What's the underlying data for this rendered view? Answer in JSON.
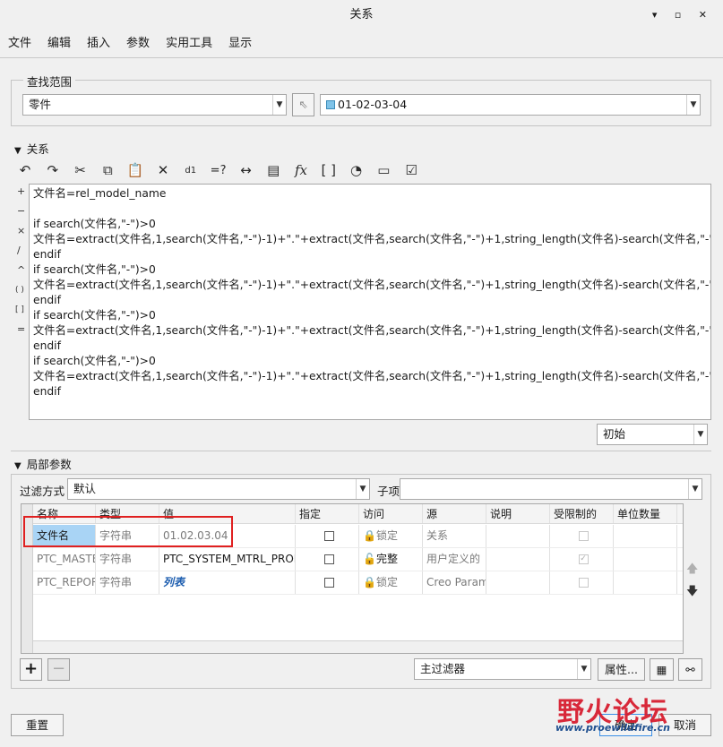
{
  "window": {
    "title": "关系",
    "buttons": "▾ ▫ ✕"
  },
  "menu": [
    "文件",
    "编辑",
    "插入",
    "参数",
    "实用工具",
    "显示"
  ],
  "scope": {
    "label": "查找范围",
    "type": "零件",
    "model": "01-02-03-04"
  },
  "relations": {
    "label": "关系",
    "text": "文件名=rel_model_name\n\nif search(文件名,\"-\")>0\n文件名=extract(文件名,1,search(文件名,\"-\")-1)+\".\"+extract(文件名,search(文件名,\"-\")+1,string_length(文件名)-search(文件名,\"-\"))\nendif\nif search(文件名,\"-\")>0\n文件名=extract(文件名,1,search(文件名,\"-\")-1)+\".\"+extract(文件名,search(文件名,\"-\")+1,string_length(文件名)-search(文件名,\"-\"))\nendif\nif search(文件名,\"-\")>0\n文件名=extract(文件名,1,search(文件名,\"-\")-1)+\".\"+extract(文件名,search(文件名,\"-\")+1,string_length(文件名)-search(文件名,\"-\"))\nendif\nif search(文件名,\"-\")>0\n文件名=extract(文件名,1,search(文件名,\"-\")-1)+\".\"+extract(文件名,search(文件名,\"-\")+1,string_length(文件名)-search(文件名,\"-\"))\nendif",
    "sort": "初始",
    "symbols": [
      "+",
      "−",
      "×",
      "/",
      "^",
      "( )",
      "[ ]",
      "="
    ]
  },
  "local_params": {
    "label": "局部参数",
    "filter_label": "过滤方式",
    "filter_value": "默认",
    "child_label": "子项",
    "child_value": "",
    "columns": [
      "名称",
      "类型",
      "值",
      "指定",
      "访问",
      "源",
      "说明",
      "受限制的",
      "单位数量"
    ],
    "rows": [
      {
        "name": "文件名",
        "type": "字符串",
        "value": "01.02.03.04",
        "access": "锁定",
        "source": "关系",
        "desc": "",
        "restricted": false,
        "units": ""
      },
      {
        "name": "PTC_MASTER",
        "type": "字符串",
        "value": "PTC_SYSTEM_MTRL_PROPS",
        "access": "完整",
        "source": "用户定义的",
        "desc": "",
        "restricted": true,
        "units": ""
      },
      {
        "name": "PTC_REPORT",
        "type": "字符串",
        "value": "列表",
        "access": "锁定",
        "source": "Creo Parametric",
        "desc": "",
        "restricted": false,
        "units": ""
      }
    ],
    "main_filter": "主过滤器",
    "props_btn": "属性..."
  },
  "footer": {
    "reset": "重置",
    "ok": "确定",
    "cancel": "取消"
  },
  "watermark": {
    "text": "野火论坛",
    "url": "www.proewildfire.cn"
  }
}
